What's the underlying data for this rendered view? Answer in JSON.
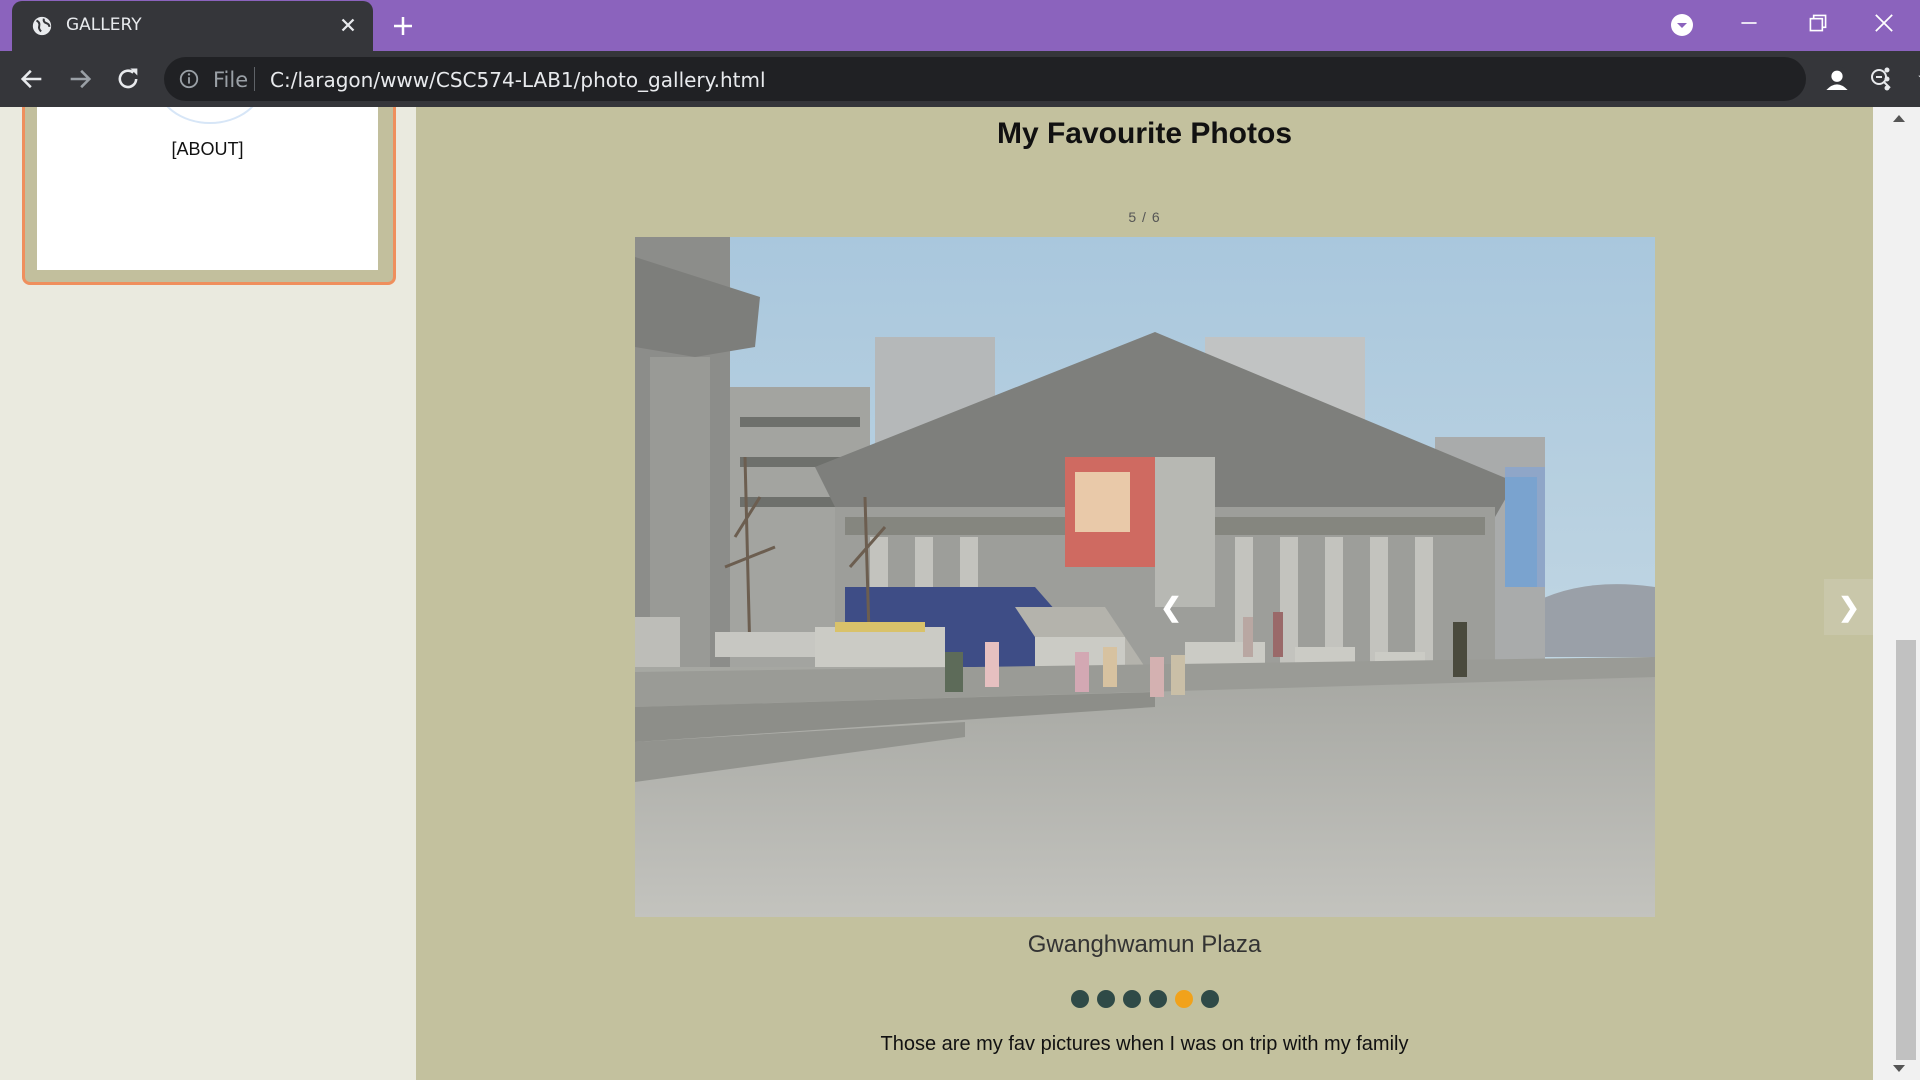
{
  "browser": {
    "tab_title": "GALLERY",
    "omnibox_prefix": "File",
    "url": "C:/laragon/www/CSC574-LAB1/photo_gallery.html",
    "accent_color": "#8b63bd"
  },
  "sidebar": {
    "about_link": "[ABOUT]"
  },
  "gallery": {
    "heading": "My Favourite Photos",
    "counter": "5 / 6",
    "caption": "Gwanghwamun Plaza",
    "prev_arrow": "❮",
    "next_arrow": "❯",
    "total_slides": 6,
    "active_slide": 5,
    "description": "Those are my fav pictures when I was on trip with my family",
    "active_dot_color": "#f1a21b",
    "dot_color": "#2f4a47"
  },
  "icons": [
    "globe-icon",
    "close-icon",
    "plus-icon",
    "profile-menu-icon",
    "minimize-icon",
    "maximize-icon",
    "window-close-icon",
    "back-icon",
    "forward-icon",
    "reload-icon",
    "info-icon",
    "zoom-icon",
    "star-icon",
    "account-icon",
    "menu-icon"
  ]
}
